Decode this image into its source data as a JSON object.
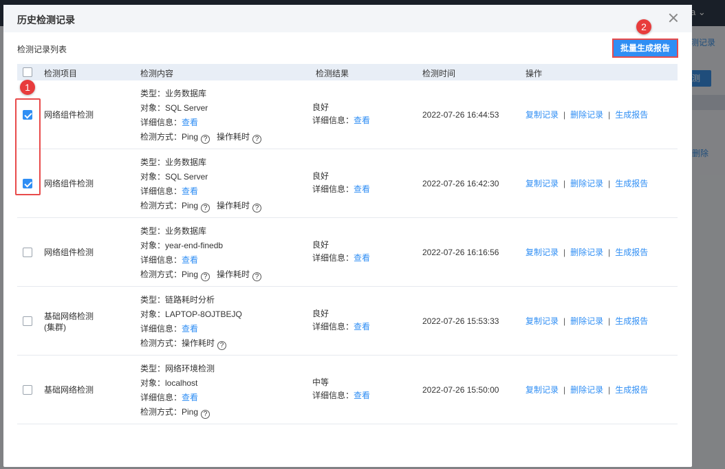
{
  "background": {
    "user_name": "a",
    "records_link": "测记录",
    "button_fragment": "测",
    "delete_fragment": "删除"
  },
  "modal": {
    "title": "历史检测记录",
    "section_label": "检测记录列表",
    "batch_button": "批量生成报告",
    "markers": [
      "1",
      "2"
    ]
  },
  "table": {
    "headers": {
      "item": "检测项目",
      "content": "检测内容",
      "result": "检测结果",
      "time": "检测时间",
      "actions": "操作"
    },
    "labels": {
      "type": "类型：",
      "object": "对象：",
      "details": "详细信息：",
      "view": "查看",
      "method": "检测方式："
    },
    "action_labels": {
      "copy": "复制记录",
      "delete": "删除记录",
      "report": "生成报告",
      "separator": "|"
    },
    "rows": [
      {
        "checked": true,
        "item": "网络组件检测",
        "type": "业务数据库",
        "object": "SQL Server",
        "method": "Ping",
        "extra_method": "操作耗时",
        "result": "良好",
        "time": "2022-07-26 16:44:53"
      },
      {
        "checked": true,
        "item": "网络组件检测",
        "type": "业务数据库",
        "object": "SQL Server",
        "method": "Ping",
        "extra_method": "操作耗时",
        "result": "良好",
        "time": "2022-07-26 16:42:30"
      },
      {
        "checked": false,
        "item": "网络组件检测",
        "type": "业务数据库",
        "object": "year-end-finedb",
        "method": "Ping",
        "extra_method": "操作耗时",
        "result": "良好",
        "time": "2022-07-26 16:16:56"
      },
      {
        "checked": false,
        "item": "基础网络检测",
        "item_sub": "(集群)",
        "type": "链路耗时分析",
        "object": "LAPTOP-8OJTBEJQ",
        "method": "操作耗时",
        "result": "良好",
        "time": "2022-07-26 15:53:33"
      },
      {
        "checked": false,
        "item": "基础网络检测",
        "type": "网络环境检测",
        "object": "localhost",
        "method": "Ping",
        "result": "中等",
        "time": "2022-07-26 15:50:00"
      }
    ]
  },
  "colors": {
    "accent": "#2f8ef4",
    "highlight": "#e84a4a"
  }
}
